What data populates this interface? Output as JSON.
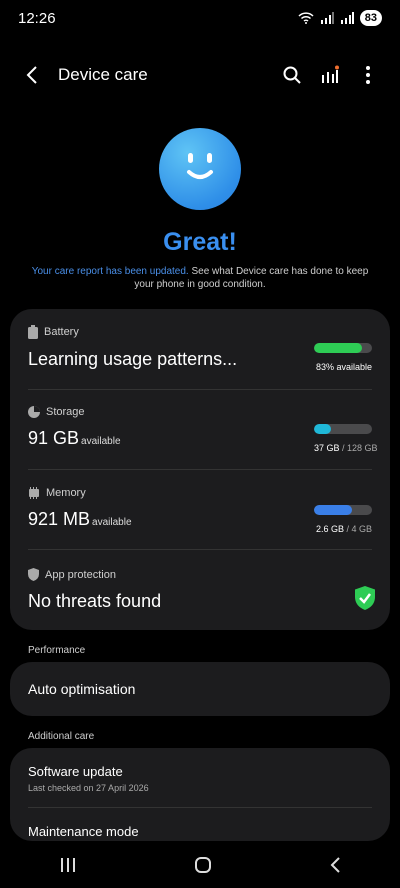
{
  "status": {
    "time": "12:26",
    "battery": "83"
  },
  "appbar": {
    "title": "Device care"
  },
  "hero": {
    "headline": "Great!",
    "report_highlight": "Your care report has been updated.",
    "report_rest": " See what Device care has done to keep your phone in good condition."
  },
  "battery": {
    "label": "Battery",
    "status": "Learning usage patterns...",
    "percent": 83,
    "available_text": "83% available",
    "color": "#2ecc55"
  },
  "storage": {
    "label": "Storage",
    "value": "91 GB",
    "suffix": "available",
    "used": "37 GB",
    "total": "/ 128 GB",
    "fraction": 0.289,
    "color": "#1fb8d8"
  },
  "memory": {
    "label": "Memory",
    "value": "921 MB",
    "suffix": "available",
    "used": "2.6 GB",
    "total": "/ 4 GB",
    "fraction": 0.65,
    "color": "#3a7fe8"
  },
  "protection": {
    "label": "App protection",
    "status": "No threats found",
    "color": "#2ecc55"
  },
  "performance": {
    "section": "Performance",
    "item": "Auto optimisation"
  },
  "additional": {
    "section": "Additional care",
    "software_update": "Software update",
    "last_checked": "Last checked on 27 April 2026",
    "maintenance": "Maintenance mode"
  }
}
